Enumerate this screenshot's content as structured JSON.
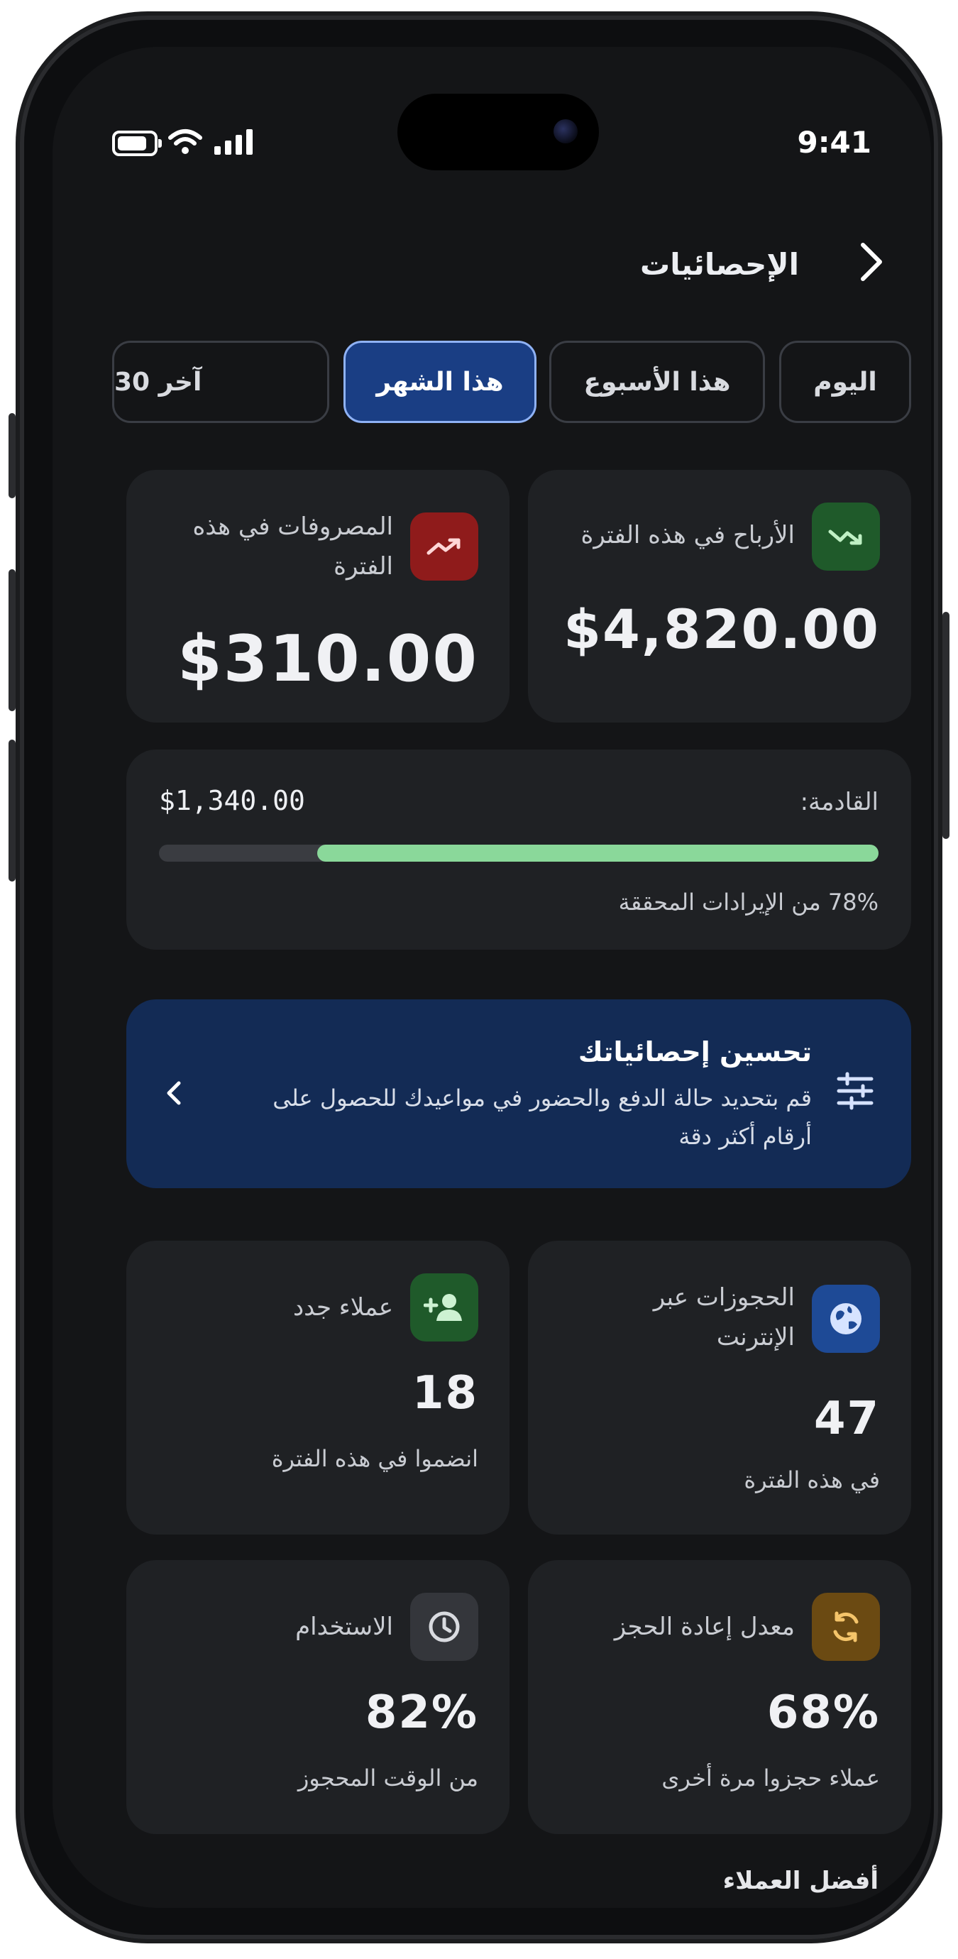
{
  "status": {
    "time": "9:41"
  },
  "header": {
    "title": "الإحصائيات"
  },
  "filters": [
    {
      "label": "اليوم",
      "active": false
    },
    {
      "label": "هذا الأسبوع",
      "active": false
    },
    {
      "label": "هذا الشهر",
      "active": true
    },
    {
      "label": "آخر 30",
      "active": false
    }
  ],
  "profit": {
    "label": "الأرباح في هذه الفترة",
    "value": "$4,820.00"
  },
  "expenses": {
    "label": "المصروفات في هذه الفترة",
    "value": "$310.00"
  },
  "upcoming": {
    "label": "القادمة:",
    "value": "$1,340.00",
    "progress": 0.78,
    "caption": "78% من الإيرادات المحققة"
  },
  "improve": {
    "title": "تحسين إحصائياتك",
    "body": "قم بتحديد حالة الدفع والحضور في مواعيدك للحصول على أرقام أكثر دقة"
  },
  "online": {
    "label": "الحجوزات عبر الإنترنت",
    "value": "47",
    "caption": "في هذه الفترة"
  },
  "new_clients": {
    "label": "عملاء جدد",
    "value": "18",
    "caption": "انضموا في هذه الفترة"
  },
  "rebook": {
    "label": "معدل إعادة الحجز",
    "value": "68%",
    "caption": "عملاء حجزوا مرة أخرى"
  },
  "usage": {
    "label": "الاستخدام",
    "value": "82%",
    "caption": "من الوقت المحجوز"
  },
  "top_clients": {
    "title": "أفضل العملاء"
  },
  "colors": {
    "accent_blue": "#1a3e84",
    "progress_green": "#8ad89a",
    "danger_red": "#8f1b1b",
    "success_green": "#1f5a2a",
    "amber": "#6b4a12"
  }
}
